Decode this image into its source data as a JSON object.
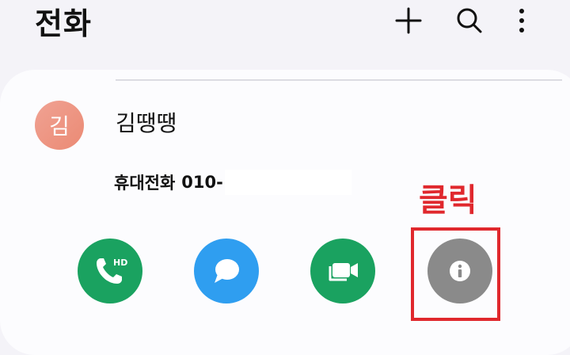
{
  "header": {
    "title": "전화",
    "actions": [
      {
        "name": "add-icon"
      },
      {
        "name": "search-icon"
      },
      {
        "name": "more-options-icon"
      }
    ]
  },
  "contact": {
    "avatar_initial": "김",
    "avatar_color": "#ee9581",
    "name": "김땡땡",
    "phone_label": "휴대전화",
    "phone_number_prefix": "010-"
  },
  "actions": [
    {
      "name": "hd-voice-call-button",
      "icon": "phone-hd-icon",
      "color": "#1aa260"
    },
    {
      "name": "message-button",
      "icon": "message-bubble-icon",
      "color": "#2f9ef0"
    },
    {
      "name": "video-call-button",
      "icon": "video-camera-icon",
      "color": "#1aa260"
    },
    {
      "name": "contact-info-button",
      "icon": "info-icon",
      "color": "#8a8a8a"
    }
  ],
  "annotation": {
    "text": "클릭",
    "color": "#e0282d"
  }
}
